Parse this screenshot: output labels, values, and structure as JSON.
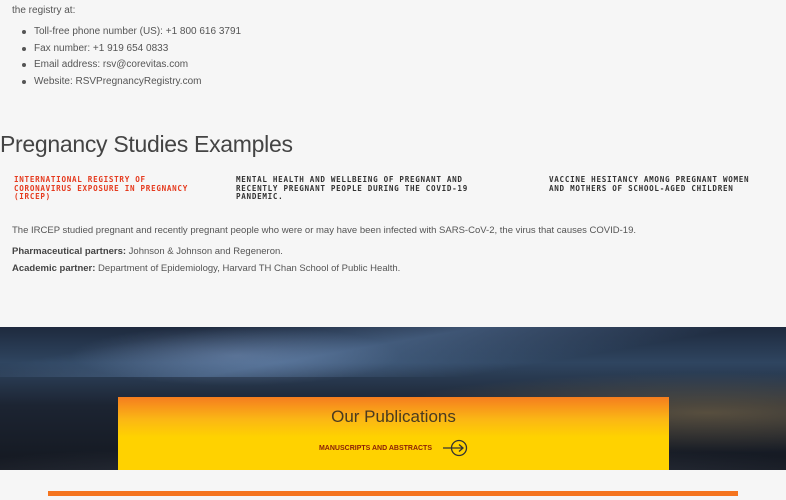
{
  "contact": {
    "intro": "the registry at:",
    "items": [
      "Toll-free phone number (US): +1 800 616 3791",
      "Fax number: +1 919 654 0833",
      "Email address: rsv@corevitas.com",
      "Website:  RSVPregnancyRegistry.com"
    ]
  },
  "studies": {
    "title": "Pregnancy Studies Examples",
    "tabs": [
      {
        "label": "International Registry of Coronavirus Exposure in Pregnancy (IRCEP)"
      },
      {
        "label": "Mental health and wellbeing of pregnant and recently pregnant people during the COVID-19 pandemic."
      },
      {
        "label": "Vaccine hesitancy among pregnant women and mothers of school-aged children"
      }
    ],
    "description": "The IRCEP studied pregnant and recently pregnant people who were or may have been infected with SARS-CoV-2, the virus that causes COVID-19.",
    "pharma_label": "Pharmaceutical partners:",
    "pharma_value": " Johnson & Johnson and Regeneron.",
    "academic_label": "Academic partner:",
    "academic_value": " Department of Epidemiology, Harvard TH Chan School of Public Health."
  },
  "publications": {
    "title": "Our Publications",
    "link": "MANUSCRIPTS AND ABSTRACTS"
  },
  "colors": {
    "accent": "#f5751f",
    "active_tab": "#e53a1e",
    "link": "#8a1e08"
  }
}
